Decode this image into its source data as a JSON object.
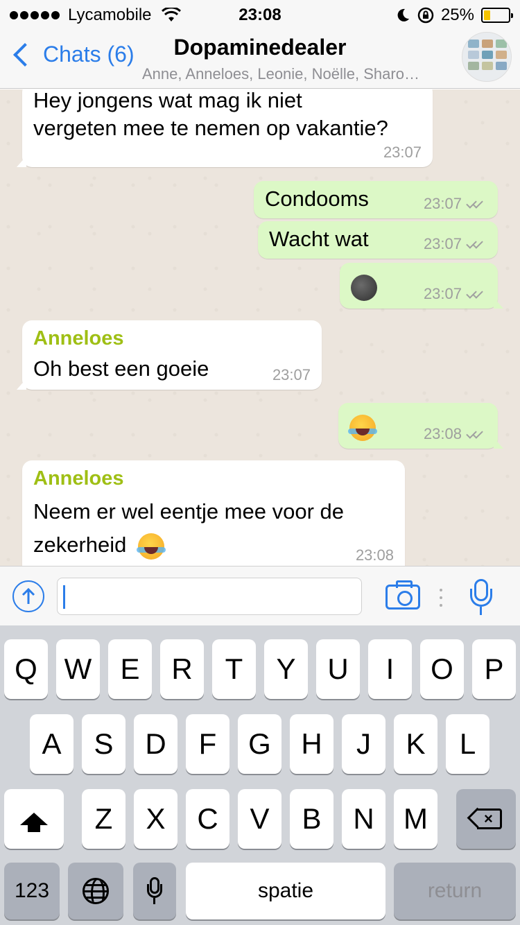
{
  "status_bar": {
    "carrier": "Lycamobile",
    "time": "23:08",
    "battery_percent": "25%",
    "battery_level": 0.25,
    "icons": [
      "signal-dots-icon",
      "wifi-icon",
      "moon-icon",
      "rotation-lock-icon",
      "battery-icon"
    ]
  },
  "nav": {
    "back_label": "Chats (6)",
    "title": "Dopaminedealer",
    "subtitle": "Anne, Anneloes, Leonie, Noëlle, Sharo…"
  },
  "messages": [
    {
      "direction": "in",
      "sender": "",
      "lines": [
        "Hey jongens wat mag ik niet",
        "vergeten mee te nemen op vakantie?"
      ],
      "time": "23:07"
    },
    {
      "direction": "out",
      "text": "Condooms",
      "time": "23:07",
      "ticks": true
    },
    {
      "direction": "out",
      "text": "Wacht wat",
      "time": "23:07",
      "ticks": true
    },
    {
      "direction": "out",
      "emoji": "new-moon-face-emoji",
      "time": "23:07",
      "ticks": true
    },
    {
      "direction": "in",
      "sender": "Anneloes",
      "text": "Oh best een goeie",
      "time": "23:07"
    },
    {
      "direction": "out",
      "emoji": "tears-of-joy-emoji",
      "time": "23:08",
      "ticks": true
    },
    {
      "direction": "in",
      "sender": "Anneloes",
      "lines": [
        "Neem er wel eentje mee voor de",
        "zekerheid"
      ],
      "emoji": "tears-of-joy-emoji",
      "time": "23:08"
    }
  ],
  "input": {
    "value": "",
    "placeholder": ""
  },
  "keyboard": {
    "row1": [
      "Q",
      "W",
      "E",
      "R",
      "T",
      "Y",
      "U",
      "I",
      "O",
      "P"
    ],
    "row2": [
      "A",
      "S",
      "D",
      "F",
      "G",
      "H",
      "J",
      "K",
      "L"
    ],
    "row3": [
      "Z",
      "X",
      "C",
      "V",
      "B",
      "N",
      "M"
    ],
    "numbers_label": "123",
    "space_label": "spatie",
    "return_label": "return"
  },
  "colors": {
    "accent": "#2b7de9",
    "sender_name": "#9fbf15",
    "outgoing_bubble": "#dcf8c6",
    "incoming_bubble": "#ffffff",
    "chat_background": "#ece5dd",
    "battery_fill": "#f5c400"
  }
}
